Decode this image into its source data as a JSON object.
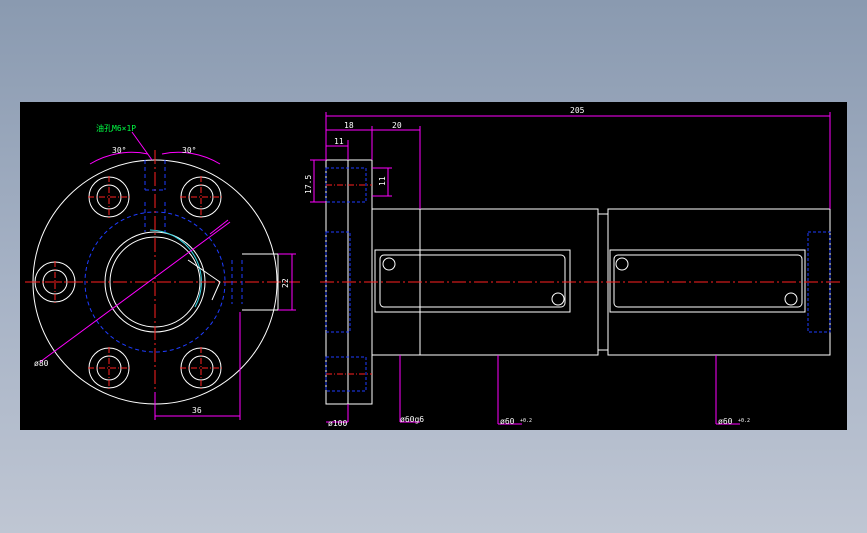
{
  "colors": {
    "background": "#000000",
    "outline": "#ffffff",
    "centerline": "#ff2020",
    "hidden": "#1e3cff",
    "dimension": "#ff00ff",
    "text": "#ffffff",
    "note": "#00ff44"
  },
  "front_view": {
    "angle_left": "30°",
    "angle_right": "30°",
    "note": "油孔M6×1P",
    "dim_width": "36",
    "dim_oil_hole": "22",
    "dim_pcd": "ø80"
  },
  "side_view": {
    "total_length": "205",
    "flange_thickness": "18",
    "offset_20": "20",
    "offset_11": "11",
    "height_17_5": "17.5",
    "height_11": "11",
    "flange_dia": "ø100",
    "spigot_dia": "ø60g6",
    "body_dia_1": "ø60",
    "body_dia_2": "ø60"
  }
}
